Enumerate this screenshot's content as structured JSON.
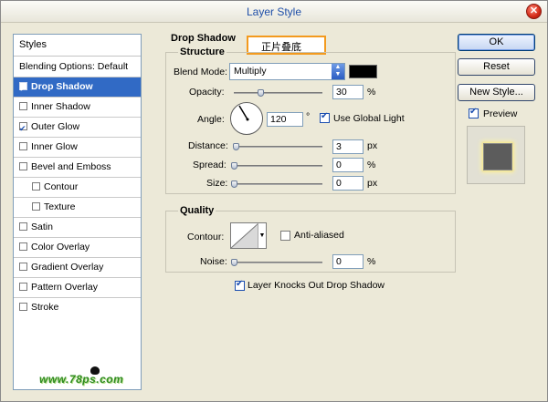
{
  "window": {
    "title": "Layer Style"
  },
  "styles_panel": {
    "header": "Styles",
    "items": [
      {
        "label": "Blending Options: Default",
        "checkbox": false,
        "checked": false,
        "selected": false,
        "indent": false
      },
      {
        "label": "Drop Shadow",
        "checkbox": true,
        "checked": true,
        "selected": true,
        "indent": false
      },
      {
        "label": "Inner Shadow",
        "checkbox": true,
        "checked": false,
        "selected": false,
        "indent": false
      },
      {
        "label": "Outer Glow",
        "checkbox": true,
        "checked": true,
        "selected": false,
        "indent": false
      },
      {
        "label": "Inner Glow",
        "checkbox": true,
        "checked": false,
        "selected": false,
        "indent": false
      },
      {
        "label": "Bevel and Emboss",
        "checkbox": true,
        "checked": false,
        "selected": false,
        "indent": false
      },
      {
        "label": "Contour",
        "checkbox": true,
        "checked": false,
        "selected": false,
        "indent": true
      },
      {
        "label": "Texture",
        "checkbox": true,
        "checked": false,
        "selected": false,
        "indent": true
      },
      {
        "label": "Satin",
        "checkbox": true,
        "checked": false,
        "selected": false,
        "indent": false
      },
      {
        "label": "Color Overlay",
        "checkbox": true,
        "checked": false,
        "selected": false,
        "indent": false
      },
      {
        "label": "Gradient Overlay",
        "checkbox": true,
        "checked": false,
        "selected": false,
        "indent": false
      },
      {
        "label": "Pattern Overlay",
        "checkbox": true,
        "checked": false,
        "selected": false,
        "indent": false
      },
      {
        "label": "Stroke",
        "checkbox": true,
        "checked": false,
        "selected": false,
        "indent": false
      }
    ],
    "watermark": "www.78ps.com"
  },
  "drop_shadow": {
    "title": "Drop Shadow",
    "annotation": "正片叠底",
    "structure": {
      "title": "Structure",
      "blend_mode_label": "Blend Mode:",
      "blend_mode_value": "Multiply",
      "shadow_color": "#000000",
      "opacity_label": "Opacity:",
      "opacity_value": "30",
      "opacity_fraction": 0.3,
      "opacity_unit": "%",
      "angle_label": "Angle:",
      "angle_value": "120",
      "angle_unit": "°",
      "global_light_label": "Use Global Light",
      "global_light_checked": true,
      "distance_label": "Distance:",
      "distance_value": "3",
      "distance_unit": "px",
      "spread_label": "Spread:",
      "spread_value": "0",
      "spread_unit": "%",
      "size_label": "Size:",
      "size_value": "0",
      "size_unit": "px"
    },
    "quality": {
      "title": "Quality",
      "contour_label": "Contour:",
      "anti_aliased_label": "Anti-aliased",
      "anti_aliased_checked": false,
      "noise_label": "Noise:",
      "noise_value": "0",
      "noise_unit": "%"
    },
    "knockout_label": "Layer Knocks Out Drop Shadow",
    "knockout_checked": true
  },
  "buttons": {
    "ok": "OK",
    "reset": "Reset",
    "new_style": "New Style...",
    "preview_label": "Preview",
    "preview_checked": true
  },
  "colors": {
    "accent": "#316ac5",
    "annotation_border": "#f39a1e",
    "title_text": "#1f4fa8"
  }
}
